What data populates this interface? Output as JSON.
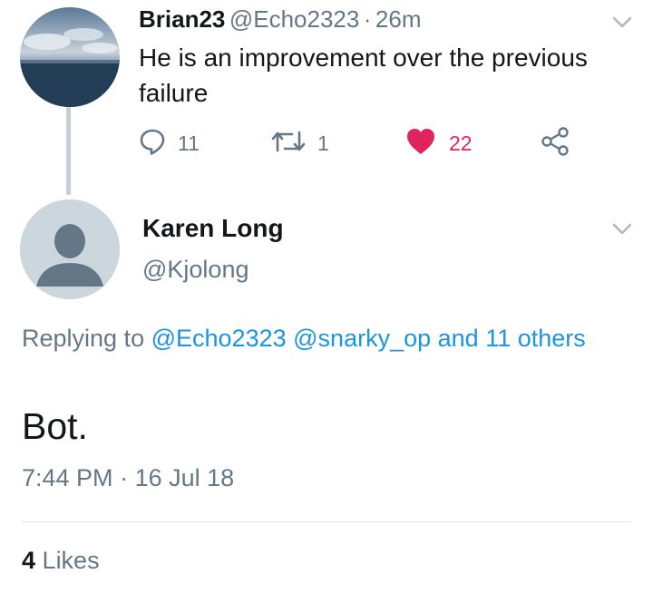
{
  "tweet1": {
    "name": "Brian23",
    "handle": "@Echo2323",
    "separator": "·",
    "time": "26m",
    "text": "He is an improvement over the previous failure",
    "replies": "11",
    "retweets": "1",
    "likes": "22"
  },
  "tweet2": {
    "name": "Karen Long",
    "handle": "@Kjolong",
    "replying_prefix": "Replying to",
    "replying_to_1": "@Echo2323",
    "replying_to_2": "@snarky_op",
    "replying_and_others": "and 11 others",
    "text": "Bot.",
    "time": "7:44 PM",
    "separator": "·",
    "date": "16 Jul 18",
    "likes_count": "4",
    "likes_label": "Likes"
  },
  "colors": {
    "accent": "#1b95e0",
    "like": "#e0245e",
    "muted": "#657786",
    "thread_line": "#c4cfd6"
  },
  "icons": [
    "reply-icon",
    "retweet-icon",
    "heart-icon",
    "share-icon",
    "chevron-down-icon",
    "default-avatar-icon"
  ]
}
